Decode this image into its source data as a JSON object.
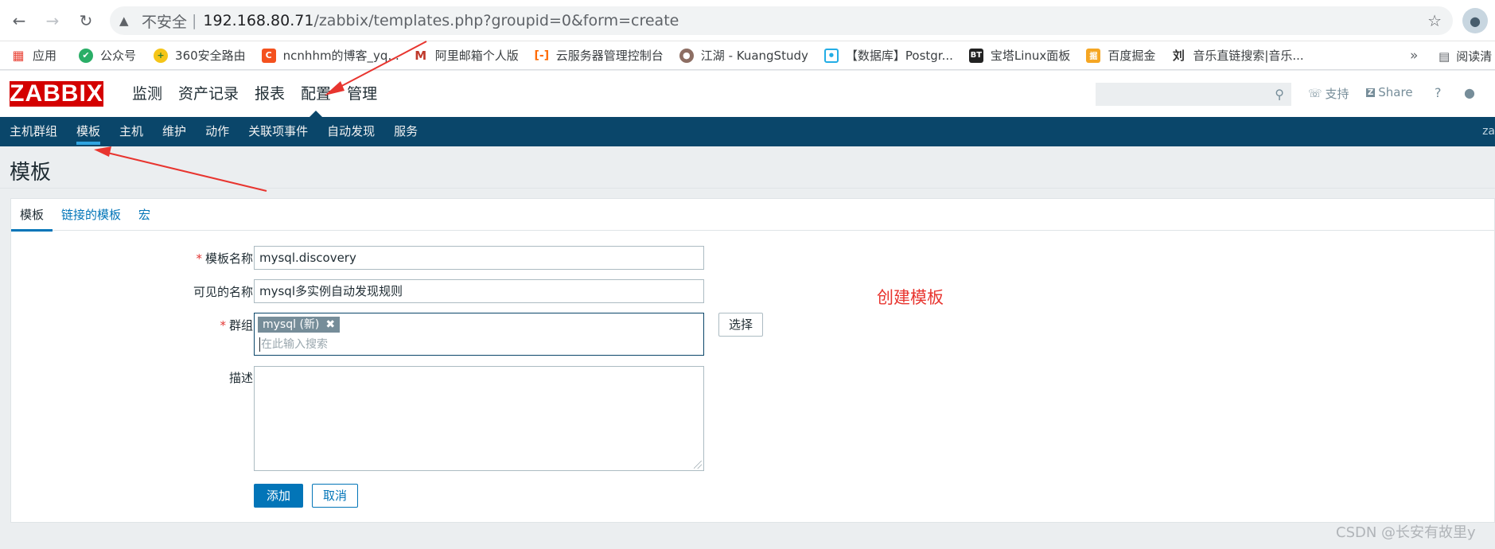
{
  "browser": {
    "security_label": "不安全",
    "url_host": "192.168.80.71",
    "url_path": "/zabbix/templates.php?groupid=0&form=create"
  },
  "bookmarks": {
    "items": [
      {
        "label": "应用",
        "icon": "apps-grid-icon",
        "color": "#e94235"
      },
      {
        "label": "公众号",
        "icon": "wechat-icon",
        "color": "#2aae67"
      },
      {
        "label": "360安全路由",
        "icon": "360-icon",
        "color": "#4caf50"
      },
      {
        "label": "ncnhhm的博客_yq...",
        "icon": "csdn-icon",
        "color": "#f4511e"
      },
      {
        "label": "阿里邮箱个人版",
        "icon": "mail-icon",
        "color": "#c0392b"
      },
      {
        "label": "云服务器管理控制台",
        "icon": "aliyun-icon",
        "color": "#ff6a00"
      },
      {
        "label": "江湖 - KuangStudy",
        "icon": "avatar-icon",
        "color": "#8d6e63"
      },
      {
        "label": "【数据库】Postgr...",
        "icon": "bilibili-icon",
        "color": "#23ade5"
      },
      {
        "label": "宝塔Linux面板",
        "icon": "bt-icon",
        "color": "#222222"
      },
      {
        "label": "百度掘金",
        "icon": "juejin-icon",
        "color": "#f5a623"
      },
      {
        "label": "音乐直链搜索|音乐...",
        "icon": "liu-icon",
        "color": "#333333"
      }
    ],
    "more": "»",
    "reading_list": "阅读清"
  },
  "zabbix": {
    "logo": "ZABBIX",
    "main_menu": [
      "监测",
      "资产记录",
      "报表",
      "配置",
      "管理"
    ],
    "support": "支持",
    "share": "Share",
    "help": "?",
    "sub_menu": [
      "主机群组",
      "模板",
      "主机",
      "维护",
      "动作",
      "关联项事件",
      "自动发现",
      "服务"
    ],
    "sub_menu_trail": "za"
  },
  "page": {
    "title": "模板",
    "tabs": [
      "模板",
      "链接的模板",
      "宏"
    ],
    "form": {
      "template_name_label": "模板名称",
      "template_name_value": "mysql.discovery",
      "visible_name_label": "可见的名称",
      "visible_name_value": "mysql多实例自动发现规则",
      "groups_label": "群组",
      "group_chip": "mysql (新)",
      "groups_placeholder": "在此输入搜索",
      "select_button": "选择",
      "description_label": "描述",
      "add_button": "添加",
      "cancel_button": "取消"
    }
  },
  "annotation": "创建模板",
  "watermark": "CSDN @长安有故里y",
  "colors": {
    "zabbix_red": "#d40000",
    "nav_blue": "#0a466a",
    "link_blue": "#0275b8",
    "annotation_red": "#e8352f"
  }
}
